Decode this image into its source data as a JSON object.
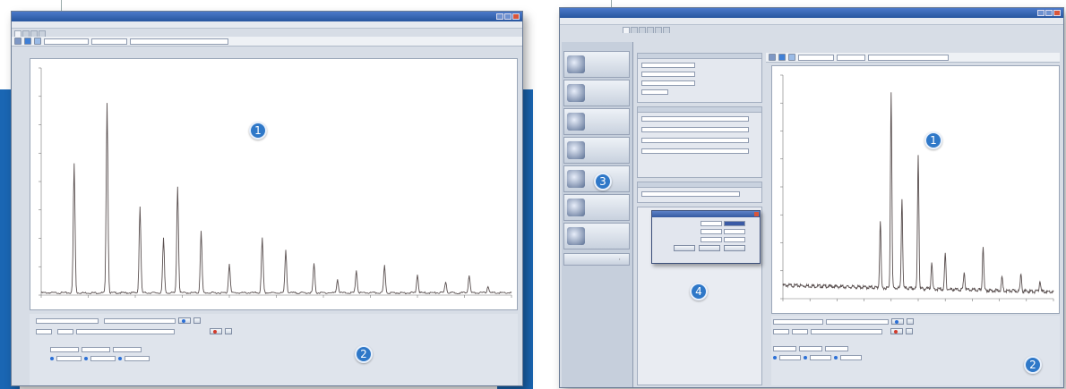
{
  "left_window": {
    "title": "",
    "tabs": [
      "",
      "",
      "",
      ""
    ],
    "toolbar": {
      "combo_a": "",
      "combo_b": "",
      "combo_c": ""
    },
    "plot": {
      "x_ticks": [
        "",
        "",
        "",
        "",
        "",
        "",
        "",
        "",
        "",
        ""
      ]
    },
    "controls": {
      "start_label": "",
      "start_value": "",
      "scan_mode_label": "",
      "scan_mode_value": "",
      "start_btn": "",
      "continue_btn": "",
      "stop_btn": "",
      "add_btn": "",
      "time_label": "",
      "time_value": "",
      "steps_label": "",
      "steps_value": "",
      "param_label": "",
      "start_col": "",
      "increment_col": "",
      "stop_col": "",
      "row1_name": "",
      "row1_start": "",
      "row1_inc": "",
      "row1_stop": "",
      "row2_name": "",
      "row2_start": "",
      "row2_inc": "",
      "row2_stop": ""
    }
  },
  "right_window": {
    "title": "",
    "tabs": [
      "",
      "",
      "",
      "",
      "",
      ""
    ],
    "nav_items": [
      "",
      "",
      "",
      "",
      "",
      "",
      ""
    ],
    "groups": {
      "xray_generator": "",
      "instrument": "",
      "detector": ""
    },
    "dialog": {
      "title": "",
      "rows": [
        {
          "label": "",
          "a": "",
          "b": ""
        },
        {
          "label": "",
          "a": "",
          "b": ""
        },
        {
          "label": "",
          "a": "",
          "b": ""
        }
      ],
      "buttons": [
        "",
        "",
        ""
      ]
    },
    "controls": {
      "start_btn": "",
      "continue_btn": "",
      "stop_btn": "",
      "add_btn": ""
    }
  },
  "callouts": [
    "1",
    "2",
    "1",
    "2",
    "3",
    "4"
  ],
  "colors": {
    "accent_blue": "#1a66b3",
    "callout": "#2f78c8",
    "trace": "#5a5050"
  },
  "chart_left": {
    "type": "line",
    "peaks": [
      0.07,
      0.14,
      0.21,
      0.26,
      0.29,
      0.34,
      0.4,
      0.47,
      0.52,
      0.58,
      0.63,
      0.67,
      0.73,
      0.8,
      0.86,
      0.91,
      0.95
    ],
    "heights": [
      0.57,
      0.84,
      0.38,
      0.24,
      0.47,
      0.27,
      0.13,
      0.24,
      0.19,
      0.13,
      0.06,
      0.1,
      0.12,
      0.08,
      0.05,
      0.08,
      0.03
    ]
  },
  "chart_right": {
    "type": "line",
    "peaks": [
      0.36,
      0.4,
      0.44,
      0.5,
      0.55,
      0.6,
      0.67,
      0.74,
      0.81,
      0.88,
      0.95
    ],
    "heights": [
      0.3,
      0.88,
      0.4,
      0.6,
      0.12,
      0.16,
      0.08,
      0.2,
      0.06,
      0.08,
      0.05
    ]
  }
}
